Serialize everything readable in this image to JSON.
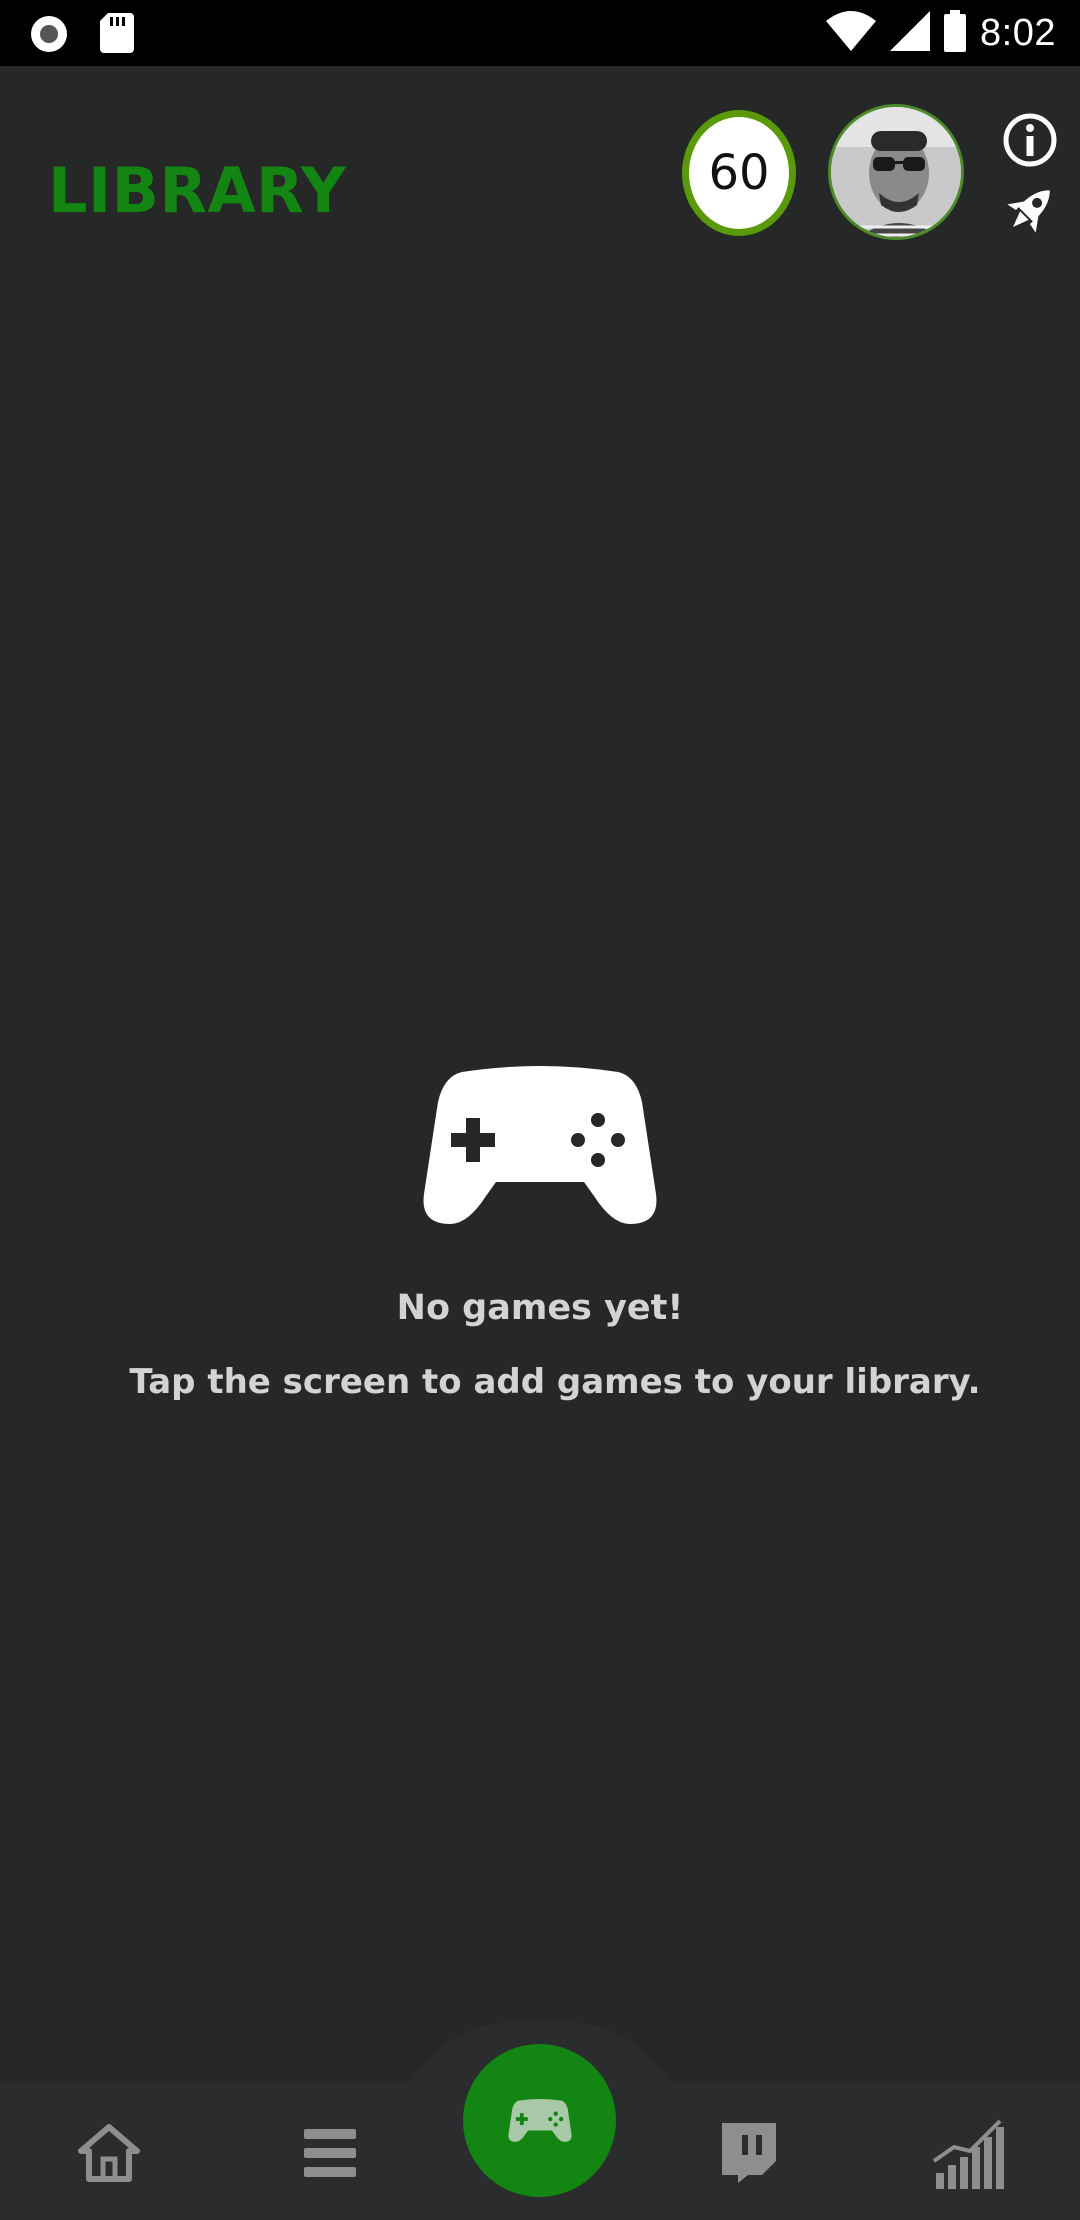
{
  "status_bar": {
    "time": "8:02",
    "left_icons": [
      "record-icon",
      "sd-card-icon"
    ],
    "right_icons": [
      "wifi-icon",
      "signal-icon",
      "battery-icon"
    ]
  },
  "header": {
    "title": "LIBRARY",
    "level": "60",
    "icons": [
      "info-icon",
      "rocket-icon"
    ]
  },
  "empty_state": {
    "icon": "gamepad-icon",
    "title": "No games yet!",
    "subtitle": "Tap the screen to add games to your library."
  },
  "bottom_nav": {
    "items": [
      {
        "icon": "home-icon"
      },
      {
        "icon": "menu-icon"
      },
      {
        "icon": "gamepad-icon",
        "active": true
      },
      {
        "icon": "twitch-icon"
      },
      {
        "icon": "stats-icon"
      }
    ]
  },
  "colors": {
    "background": "#262828",
    "accent": "#128512",
    "level_ring": "#5a9a0a",
    "text_muted": "#d3d3d3",
    "nav_background": "#2a2c2d"
  }
}
